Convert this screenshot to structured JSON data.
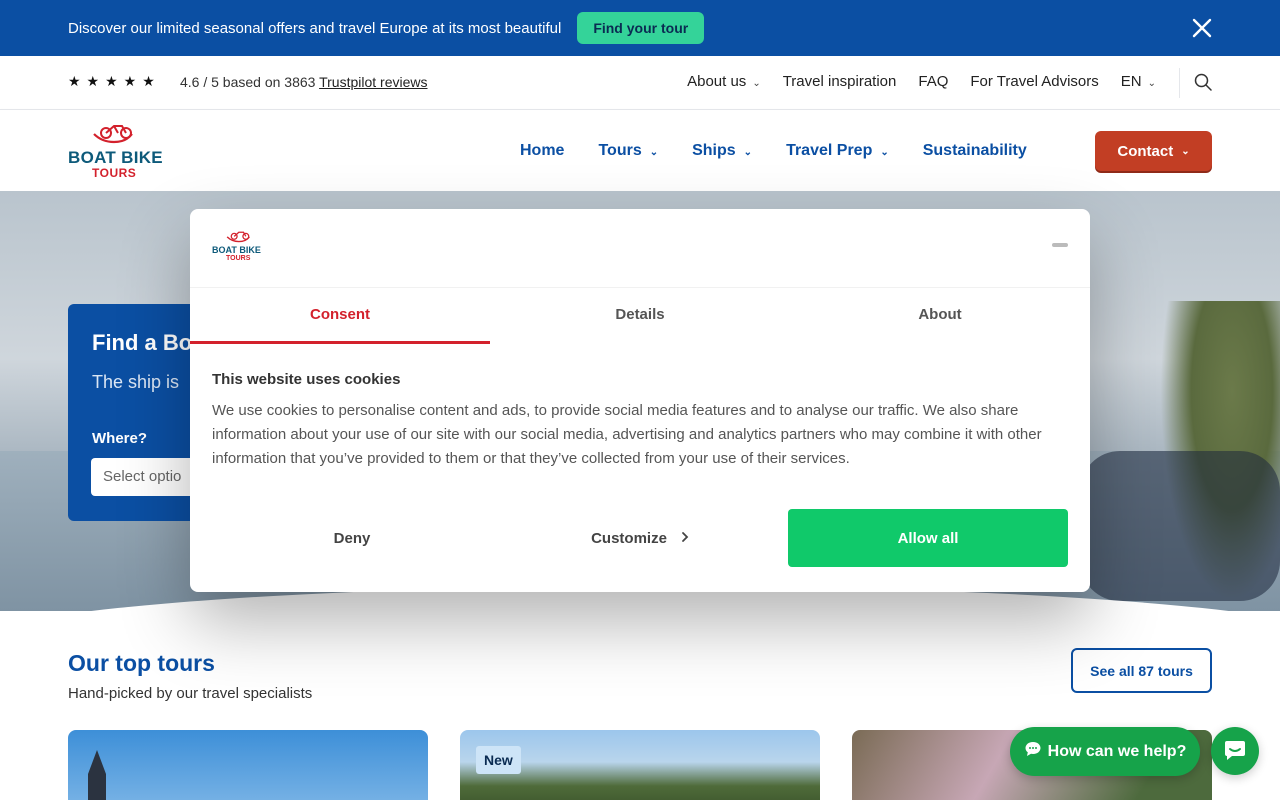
{
  "promo": {
    "text": "Discover our limited seasonal offers and travel Europe at its most beautiful",
    "button": "Find your tour"
  },
  "utility": {
    "stars": "★★★★★",
    "rating_prefix": "4.6 / 5 based on 3863 ",
    "rating_link": "Trustpilot reviews",
    "nav": [
      {
        "label": "About us",
        "has_dropdown": true
      },
      {
        "label": "Travel inspiration",
        "has_dropdown": false
      },
      {
        "label": "FAQ",
        "has_dropdown": false
      },
      {
        "label": "For Travel Advisors",
        "has_dropdown": false
      },
      {
        "label": "EN",
        "has_dropdown": true
      }
    ]
  },
  "brand": {
    "line1": "BOAT BIKE",
    "line2": "TOURS",
    "color_primary": "#0d5a7a",
    "color_accent": "#d3212c"
  },
  "main_nav": [
    {
      "label": "Home",
      "has_dropdown": false
    },
    {
      "label": "Tours",
      "has_dropdown": true
    },
    {
      "label": "Ships",
      "has_dropdown": true
    },
    {
      "label": "Travel Prep",
      "has_dropdown": true
    },
    {
      "label": "Sustainability",
      "has_dropdown": false
    }
  ],
  "contact_button": "Contact",
  "finder": {
    "title": "Find a Bo",
    "subtitle": "The ship is",
    "label": "Where?",
    "select_placeholder": "Select optio"
  },
  "cookie": {
    "tabs": [
      "Consent",
      "Details",
      "About"
    ],
    "active_tab": "Consent",
    "heading": "This website uses cookies",
    "body": "We use cookies to personalise content and ads, to provide social media features and to analyse our traffic. We also share information about your use of our site with our social media, advertising and analytics partners who may combine it with other information that you’ve provided to them or that they’ve collected from your use of their services.",
    "deny": "Deny",
    "customize": "Customize",
    "allow": "Allow all"
  },
  "top_tours": {
    "title": "Our top tours",
    "subtitle": "Hand-picked by our travel specialists",
    "see_all": "See all 87 tours",
    "badge_new": "New"
  },
  "chat": {
    "label": "How can we help?"
  },
  "colors": {
    "brand_blue": "#0b4fa3",
    "contact_red": "#c23e24",
    "allow_green": "#10c96a",
    "promo_green": "#34d399"
  }
}
